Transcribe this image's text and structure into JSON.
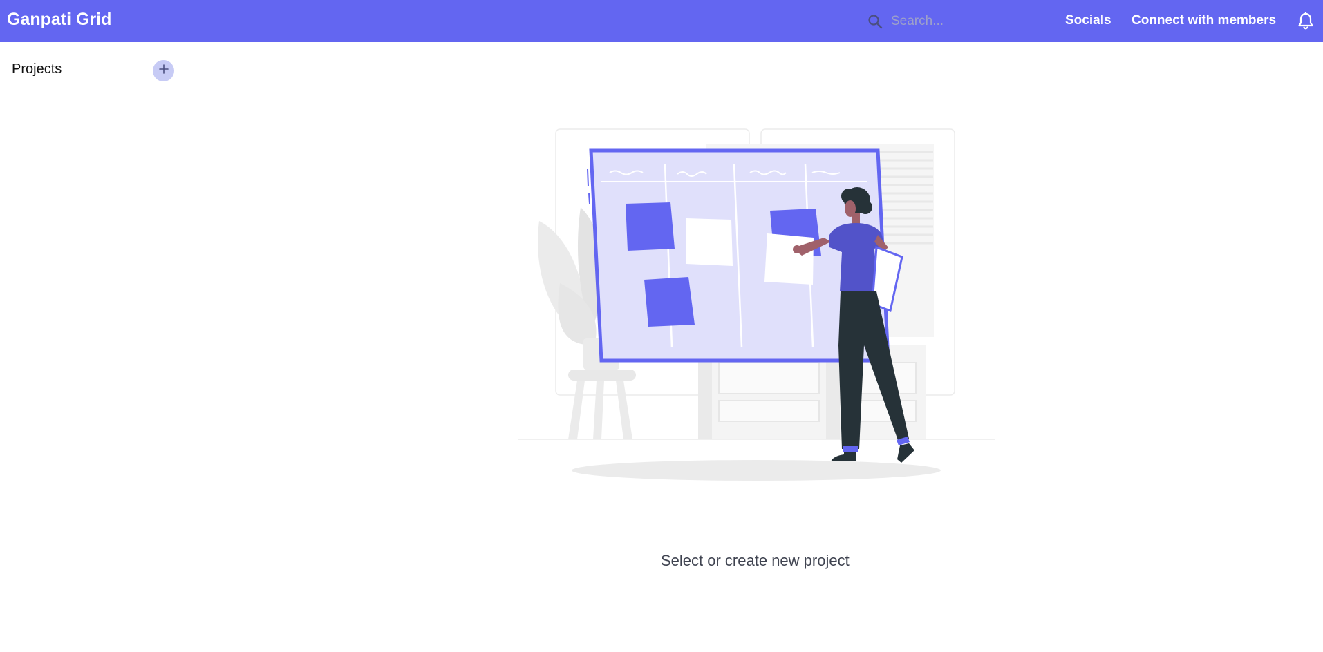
{
  "header": {
    "brand": "Ganpati Grid",
    "search_placeholder": "Search...",
    "search_icon": "search-icon",
    "nav": {
      "socials": "Socials",
      "connect": "Connect with members"
    },
    "bell_icon": "bell-icon",
    "bg_color": "#6366f1"
  },
  "sidebar": {
    "projects_label": "Projects",
    "add_icon": "plus-icon"
  },
  "main": {
    "empty_message": "Select or create new project",
    "illustration": "kanban-board-illustration"
  },
  "colors": {
    "accent": "#6366f1",
    "accent_light": "#e0e0fb",
    "add_button_bg": "#c7cbf5"
  }
}
